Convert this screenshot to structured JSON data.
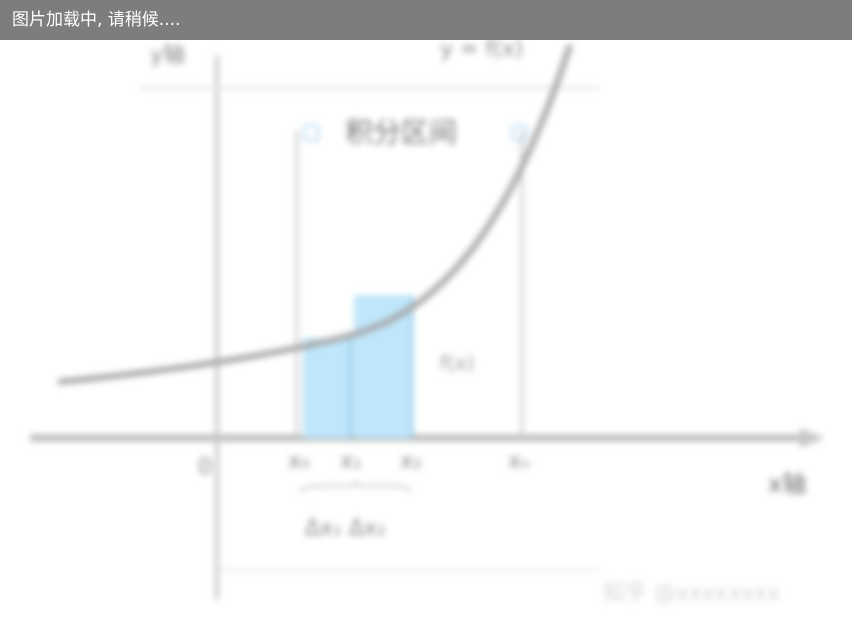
{
  "loading_bar": {
    "text": "图片加载中, 请稍候...."
  },
  "figure": {
    "y_axis_label": "y轴",
    "x_axis_label": "x轴",
    "origin_label": "0",
    "function_label": "y = f(x)",
    "interval_label": "积分区间",
    "height_label": "f(x)",
    "tick_labels": [
      "x₀",
      "x₁",
      "x₂",
      "xₙ"
    ],
    "delta_labels": "Δx₁  Δx₂",
    "watermark": "知乎 @xxxxxxxx",
    "colors": {
      "bar": "#7d7d7d",
      "fill": "#bfe6fb",
      "curve": "#9a9a9a",
      "axis": "#bbbbbb",
      "marker": "#7ab8e6"
    }
  }
}
